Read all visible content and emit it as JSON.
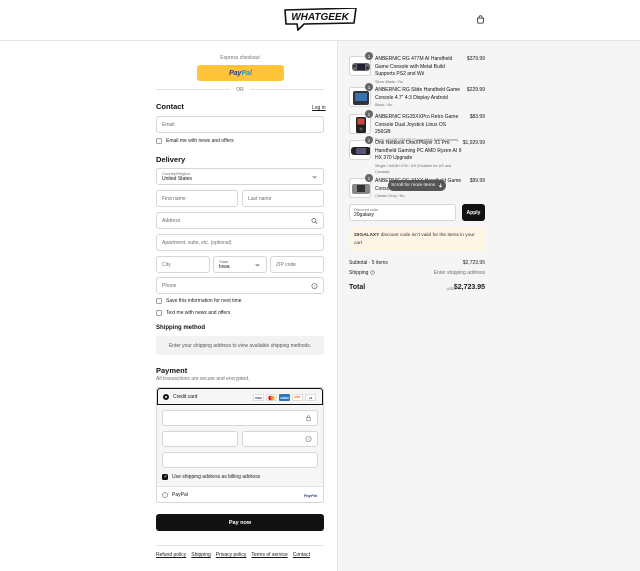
{
  "brand": {
    "logo_text": "WHATGEEK"
  },
  "express": {
    "label": "Express checkout",
    "paypal_part1": "Pay",
    "paypal_part2": "Pal",
    "or": "OR"
  },
  "contact": {
    "title": "Contact",
    "login": "Log in",
    "email_placeholder": "Email",
    "newsletter": "Email me with news and offers"
  },
  "delivery": {
    "title": "Delivery",
    "country_label": "Country/Region",
    "country_value": "United States",
    "first_name": "First name",
    "last_name": "Last name",
    "address": "Address",
    "apartment": "Apartment, suite, etc. (optional)",
    "city": "City",
    "state_label": "State",
    "state_value": "Iowa",
    "zip": "ZIP code",
    "phone": "Phone",
    "save_info": "Save this information for next time",
    "text_me": "Text me with news and offers"
  },
  "shipping": {
    "title": "Shipping method",
    "info": "Enter your shipping address to view available shipping methods."
  },
  "payment": {
    "title": "Payment",
    "subtitle": "All transactions are secure and encrypted.",
    "credit_card": "Credit card",
    "cards": [
      "VISA",
      "MC",
      "AMEX",
      "DISC",
      "+2"
    ],
    "billing_same": "Use shipping address as billing address",
    "paypal": "PayPal",
    "paypal_logo": "PayPal"
  },
  "pay_now": "Pay now",
  "footer": [
    "Refund policy",
    "Shipping",
    "Privacy policy",
    "Terms of service",
    "Contact"
  ],
  "order": {
    "items": [
      {
        "qty": "1",
        "name": "ANBERNIC RG 477M AI Handheld Game Console with Metal Build Supports PS2 and Wii",
        "variant": "Silver Blade / No",
        "price": "$379.99"
      },
      {
        "qty": "1",
        "name": "ANBERNIC RG Slide Handheld Game Console 4.7\" 4:3 Display Android",
        "variant": "Black / No",
        "price": "$229.99"
      },
      {
        "qty": "1",
        "name": "ANBERNIC RG35XXPro Retro Game Console Dual Joystick Linux OS 256GB",
        "variant": "Black / 64GB+256GB (Compatible 5400+ games)",
        "price": "$83.99"
      },
      {
        "qty": "1",
        "name": "One Netbook OneXPlayer X1 Pro Handheld Gaming PC AMD Ryzen AI 9 HX 370 Upgrade",
        "variant": "Single / 64GB+4TB / US (Suitable for US and Canada)",
        "price": "$1,929.99"
      },
      {
        "qty": "1",
        "name": "ANBERNIC RG 34XX Handheld Game Console",
        "variant": "Classic Gray / No",
        "price": "$99.99"
      }
    ],
    "scroll_hint": "Scroll for more items",
    "discount_label": "Discount code",
    "discount_value": "20galaxy",
    "apply": "Apply",
    "warning_code": "20GALAXY",
    "warning_text": " discount code isn't valid for the items in your cart",
    "subtotal_label": "Subtotal · 5 items",
    "subtotal_value": "$2,723.95",
    "shipping_label": "Shipping",
    "shipping_value": "Enter shipping address",
    "total_label": "Total",
    "currency": "USD",
    "total_value": "$2,723.95"
  }
}
